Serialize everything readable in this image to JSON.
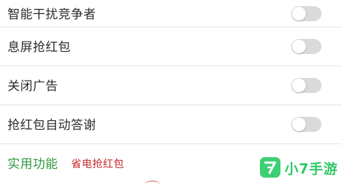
{
  "settings": {
    "items": [
      {
        "label": "智能干扰竞争者",
        "enabled": false
      },
      {
        "label": "息屏抢红包",
        "enabled": false
      },
      {
        "label": "关闭广告",
        "enabled": false
      },
      {
        "label": "抢红包自动答谢",
        "enabled": false
      }
    ]
  },
  "section": {
    "title": "实用功能",
    "subtitle": "省电抢红包"
  },
  "watermark": {
    "logo_glyph": "7",
    "text": "小7手游"
  },
  "colors": {
    "section_title": "#2e9a3c",
    "section_subtitle": "#c62828",
    "toggle_off": "#dadada",
    "watermark_green": "#2ec866"
  }
}
